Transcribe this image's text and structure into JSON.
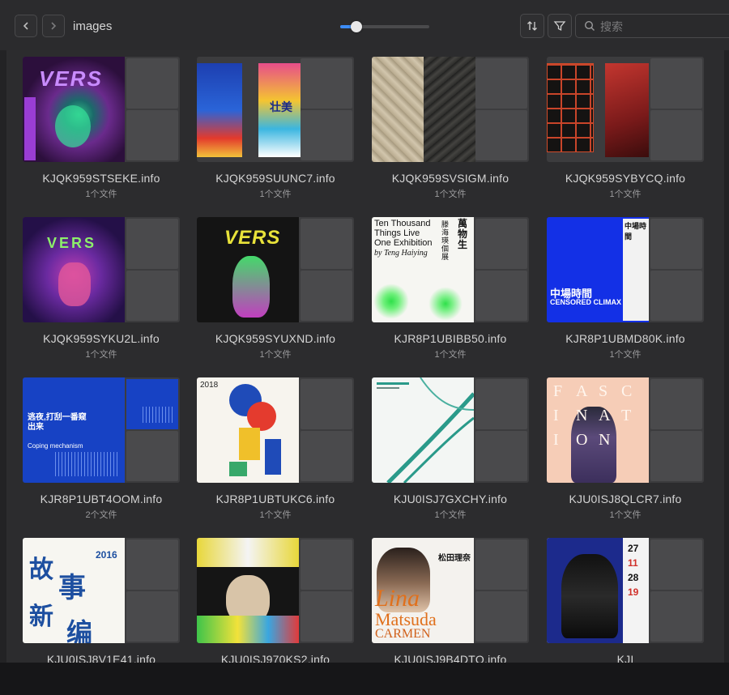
{
  "toolbar": {
    "back_icon": "chevron-left-icon",
    "forward_icon": "chevron-right-icon",
    "folder_title": "images",
    "thumbnail_size_slider_value": 0.18,
    "sort_icon": "sort-arrows-icon",
    "filter_icon": "funnel-icon",
    "search_placeholder": "搜索",
    "accent_color": "#3d8cf5"
  },
  "items": [
    {
      "name": "KJQK959STSEKE.info",
      "count": "1个文件"
    },
    {
      "name": "KJQK959SUUNC7.info",
      "count": "1个文件"
    },
    {
      "name": "KJQK959SVSIGM.info",
      "count": "1个文件"
    },
    {
      "name": "KJQK959SYBYCQ.info",
      "count": "1个文件"
    },
    {
      "name": "KJQK959SYKU2L.info",
      "count": "1个文件"
    },
    {
      "name": "KJQK959SYUXND.info",
      "count": "1个文件"
    },
    {
      "name": "KJR8P1UBIBB50.info",
      "count": "1个文件"
    },
    {
      "name": "KJR8P1UBMD80K.info",
      "count": "1个文件"
    },
    {
      "name": "KJR8P1UBT4OOM.info",
      "count": "2个文件"
    },
    {
      "name": "KJR8P1UBTUKC6.info",
      "count": "1个文件"
    },
    {
      "name": "KJU0ISJ7GXCHY.info",
      "count": "1个文件"
    },
    {
      "name": "KJU0ISJ8QLCR7.info",
      "count": "1个文件"
    },
    {
      "name": "KJU0ISJ8V1E41.info",
      "count": ""
    },
    {
      "name": "KJU0ISJ970KS2.info",
      "count": ""
    },
    {
      "name": "KJU0ISJ9B4DTQ.info",
      "count": ""
    },
    {
      "name": "KJI",
      "count": ""
    }
  ],
  "poster_text": {
    "p7_line1": "Ten Thousand",
    "p7_line2": "Things Live",
    "p7_line3": "One Exhibition",
    "p7_line4": "by Teng Haiying",
    "p7_cn": "萬物生",
    "p7_cn2": "滕海瑛個展",
    "p8_title": "中場時間",
    "p8_sub": "CENSORED CLIMAX",
    "p9_title": "Coping mechanism",
    "p9_cn": "逃夜,打刮一番窥出来",
    "p10_year": "2018",
    "p12_letters": [
      "F",
      "A",
      "S",
      "C",
      "I",
      "N",
      "A",
      "T",
      "I",
      "O",
      "N"
    ],
    "p13_year": "2016",
    "p15_name1": "Lina",
    "p15_name2": "Matsuda",
    "p15_name3": "CARMEN",
    "p15_cn": "松田理奈",
    "p16_nums": [
      "27",
      "11",
      "28",
      "19"
    ]
  }
}
